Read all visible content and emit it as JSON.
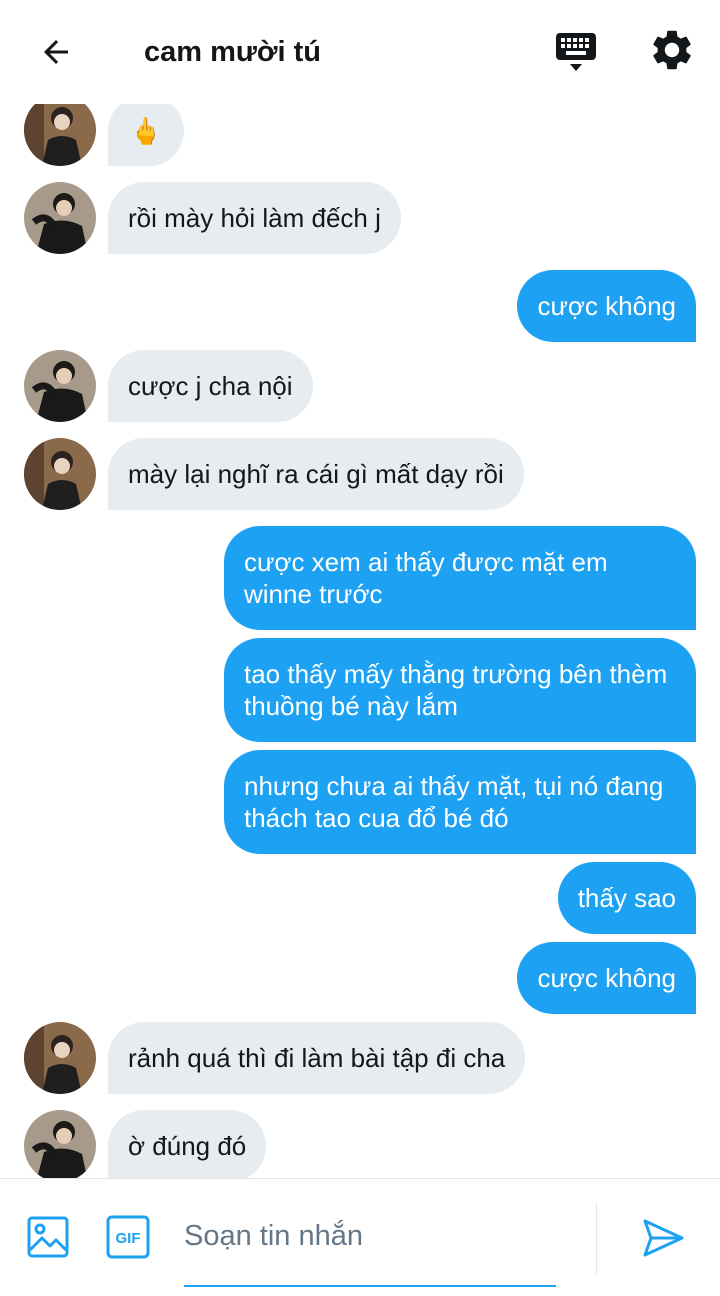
{
  "header": {
    "title": "cam mười tú",
    "back_icon": "arrow-left-icon",
    "keyboard_icon": "keyboard-icon",
    "settings_icon": "gear-icon"
  },
  "messages": [
    {
      "side": "in",
      "text": "🖕"
    },
    {
      "side": "in",
      "text": "rồi mày hỏi làm đếch j"
    },
    {
      "side": "out",
      "text": "cược không"
    },
    {
      "side": "in",
      "text": "cược j cha nội"
    },
    {
      "side": "in",
      "text": "mày lại nghĩ ra cái gì mất dạy rồi"
    },
    {
      "side": "out",
      "text": "cược xem ai thấy được mặt em winne trước"
    },
    {
      "side": "out",
      "text": "tao thấy mấy thằng trường bên thèm thuồng bé này lắm"
    },
    {
      "side": "out",
      "text": "nhưng chưa ai thấy mặt, tụi nó đang thách tao cua đổ bé đó"
    },
    {
      "side": "out",
      "text": "thấy sao"
    },
    {
      "side": "out",
      "text": "cược không"
    },
    {
      "side": "in",
      "text": "rảnh quá thì đi làm bài tập đi cha"
    },
    {
      "side": "in",
      "text": "ờ đúng đó"
    }
  ],
  "composer": {
    "placeholder": "Soạn tin nhắn",
    "value": "",
    "image_icon": "image-icon",
    "gif_icon": "gif-icon",
    "gif_label": "GIF",
    "send_icon": "send-icon"
  },
  "colors": {
    "accent": "#1da1f2",
    "incoming_bubble": "#e6ecf0",
    "text": "#14171a",
    "muted": "#657786"
  }
}
